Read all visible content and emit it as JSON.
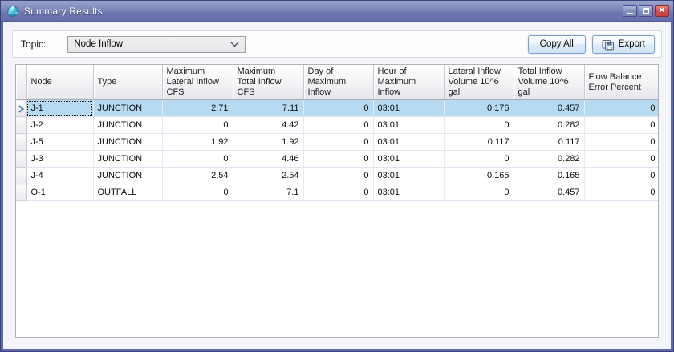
{
  "window": {
    "title": "Summary Results",
    "icons": {
      "close_glyph": "✕"
    }
  },
  "toolbar": {
    "topic_label": "Topic:",
    "topic_value": "Node Inflow",
    "copy_all_label": "Copy All",
    "export_label": "Export"
  },
  "table": {
    "headers": [
      "Node",
      "Type",
      "Maximum\nLateral Inflow\nCFS",
      "Maximum\nTotal Inflow\nCFS",
      "Day of\nMaximum\nInflow",
      "Hour of\nMaximum\nInflow",
      "Lateral Inflow\nVolume 10^6\ngal",
      "Total Inflow\nVolume 10^6\ngal",
      "Flow Balance\nError Percent"
    ],
    "rows": [
      {
        "selected": true,
        "cells": [
          "J-1",
          "JUNCTION",
          "2.71",
          "7.11",
          "0",
          "03:01",
          "0.176",
          "0.457",
          "0"
        ]
      },
      {
        "selected": false,
        "cells": [
          "J-2",
          "JUNCTION",
          "0",
          "4.42",
          "0",
          "03:01",
          "0",
          "0.282",
          "0"
        ]
      },
      {
        "selected": false,
        "cells": [
          "J-5",
          "JUNCTION",
          "1.92",
          "1.92",
          "0",
          "03:01",
          "0.117",
          "0.117",
          "0"
        ]
      },
      {
        "selected": false,
        "cells": [
          "J-3",
          "JUNCTION",
          "0",
          "4.46",
          "0",
          "03:01",
          "0",
          "0.282",
          "0"
        ]
      },
      {
        "selected": false,
        "cells": [
          "J-4",
          "JUNCTION",
          "2.54",
          "2.54",
          "0",
          "03:01",
          "0.165",
          "0.165",
          "0"
        ]
      },
      {
        "selected": false,
        "cells": [
          "O-1",
          "OUTFALL",
          "0",
          "7.1",
          "0",
          "03:01",
          "0",
          "0.457",
          "0"
        ]
      }
    ]
  },
  "colors": {
    "frame": "#5f69a7",
    "titlebar_top": "#9ba3cd",
    "titlebar_bottom": "#666fa9",
    "selection": "#b5daf2",
    "button_border": "#7ca0cd",
    "close_button": "#d9534f",
    "accent_blue": "#3a6ea5"
  }
}
